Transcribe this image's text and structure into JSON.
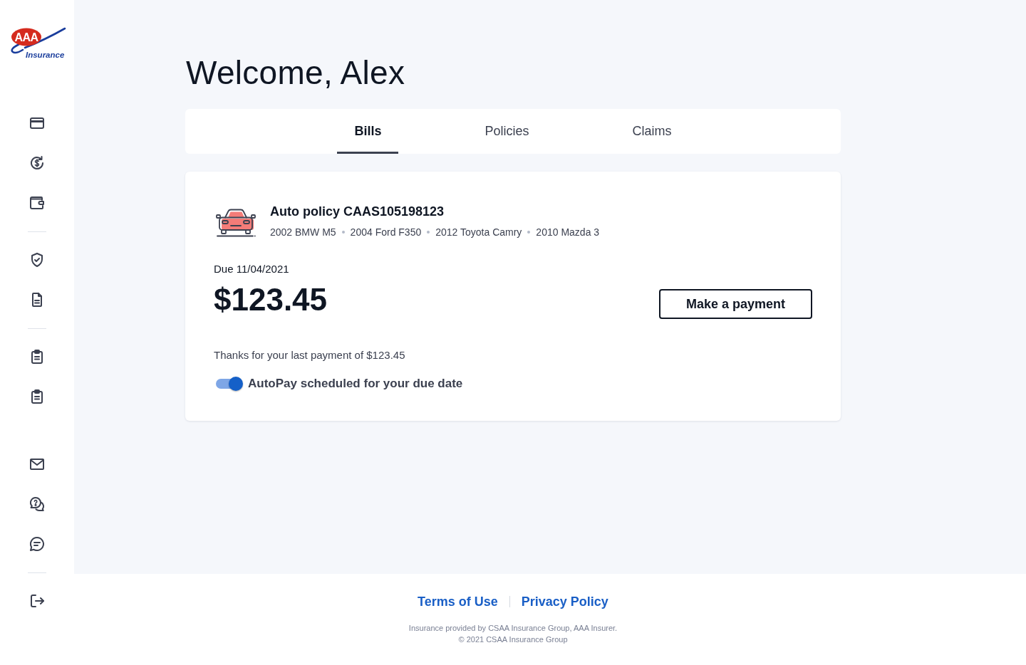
{
  "logo": {
    "letters": "AAA",
    "wordmark": "Insurance"
  },
  "heading": "Welcome, Alex",
  "tabs": [
    {
      "label": "Bills",
      "selected": true
    },
    {
      "label": "Policies",
      "selected": false
    },
    {
      "label": "Claims",
      "selected": false
    }
  ],
  "bill": {
    "title": "Auto policy CAAS105198123",
    "vehicles": [
      "2002 BMW M5",
      "2004 Ford F350",
      "2012 Toyota Camry",
      "2010 Mazda 3"
    ],
    "due": "Due 11/04/2021",
    "amount": "$123.45",
    "action": "Make a payment",
    "last_payment": "Thanks for your last payment of $123.45",
    "autopay": {
      "label": "AutoPay scheduled for your due date",
      "on": true
    }
  },
  "footer": {
    "links": [
      "Terms of Use",
      "Privacy Policy"
    ],
    "legal": [
      "Insurance provided by CSAA Insurance Group, AAA Insurer.",
      "© 2021 CSAA Insurance Group"
    ]
  }
}
